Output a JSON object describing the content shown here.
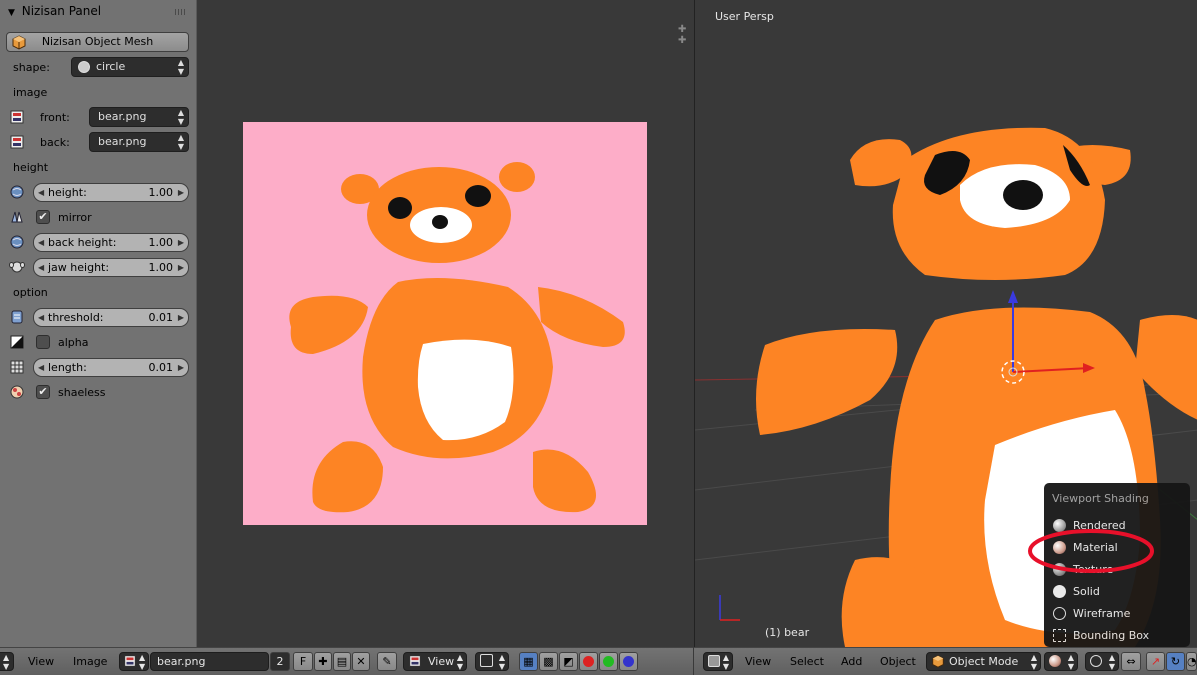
{
  "panel": {
    "title": "Nizisan Panel",
    "mesh_button": "Nizisan Object Mesh",
    "shape_label": "shape:",
    "shape_value": "circle",
    "image_section": "image",
    "front_label": "front:",
    "front_value": "bear.png",
    "back_label": "back:",
    "back_value": "bear.png",
    "height_section": "height",
    "height_field": {
      "name": "height:",
      "value": "1.00"
    },
    "mirror_label": "mirror",
    "mirror_checked": true,
    "back_height_field": {
      "name": "back height:",
      "value": "1.00"
    },
    "jaw_height_field": {
      "name": "jaw height:",
      "value": "1.00"
    },
    "option_section": "option",
    "threshold_field": {
      "name": "threshold:",
      "value": "0.01"
    },
    "alpha_label": "alpha",
    "alpha_checked": false,
    "length_field": {
      "name": "length:",
      "value": "0.01"
    },
    "shaeless_label": "shaeless",
    "shaeless_checked": true
  },
  "viewport": {
    "title": "User Persp",
    "object_label": "(1) bear"
  },
  "shading_menu": {
    "title": "Viewport Shading",
    "items": [
      "Rendered",
      "Material",
      "Texture",
      "Solid",
      "Wireframe",
      "Bounding Box"
    ],
    "highlighted": "Material"
  },
  "image_header": {
    "view": "View",
    "image": "Image",
    "image_name": "bear.png",
    "users": "2",
    "fake_user": "F",
    "view_dropdown": "View"
  },
  "view3d_header": {
    "view": "View",
    "select": "Select",
    "add": "Add",
    "object": "Object",
    "mode": "Object Mode"
  },
  "colors": {
    "bear_orange": "#fd8424",
    "background_pink": "#fdadc8",
    "annotation_red": "#e8102a",
    "panel_gray": "#727272",
    "viewport_gray": "#393939"
  }
}
